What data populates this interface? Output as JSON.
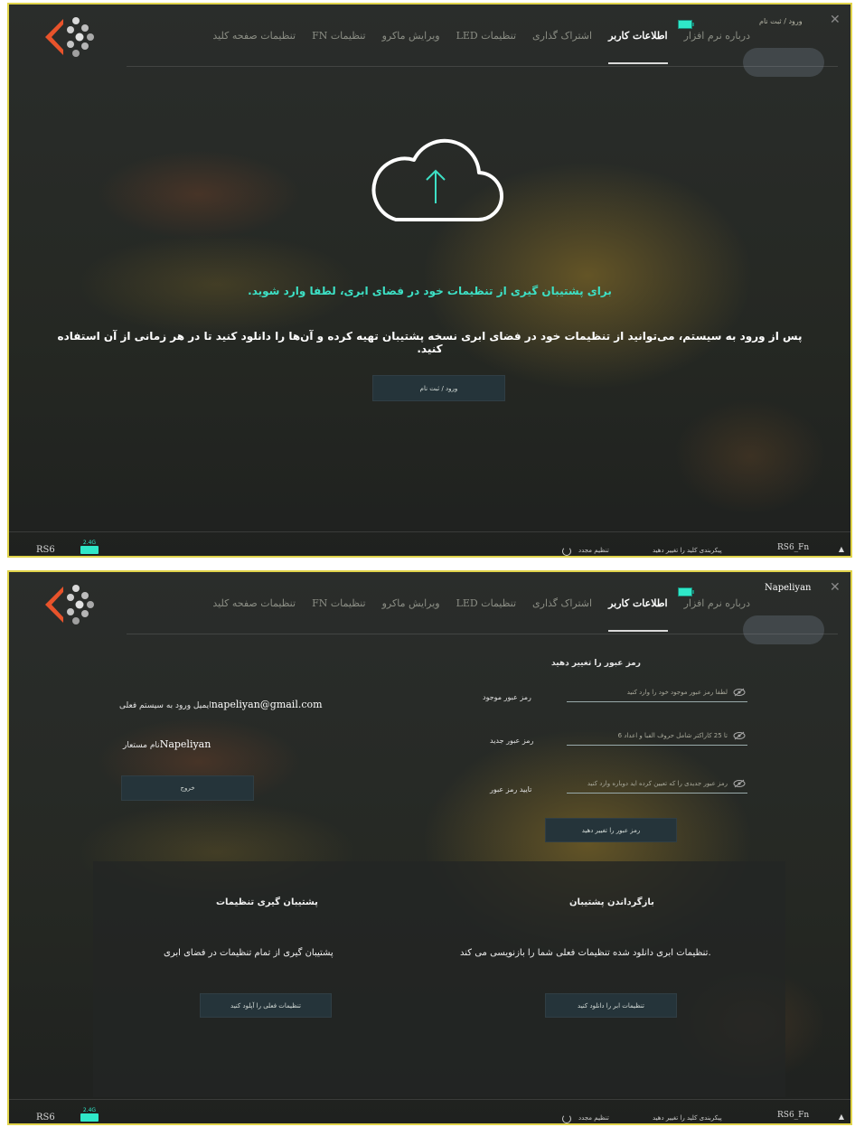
{
  "app": {
    "tabs": [
      "درباره نرم افزار",
      "اطلاعات کاربر",
      "اشتراک گذاری",
      "LED تنظیمات",
      "ویرایش ماکرو",
      "FN تنظیمات",
      "تنظیمات صفحه کلید"
    ],
    "active_tab": "اطلاعات کاربر",
    "battery_color": "#2fe8c8",
    "accent_color": "#3de0c5",
    "logo_color": "#e8532b"
  },
  "screen1": {
    "login_link": "ورود / ثبت نام",
    "cloud_icon": "cloud-upload-icon",
    "message_teal": "برای پشتیبان گیری از تنظیمات خود در فضای ابری، لطفا وارد شوید.",
    "message_white": "پس از ورود به سیستم، می‌توانید از تنظیمات خود در فضای ابری نسخه پشتیبان تهیه کرده و آن‌ها را دانلود کنید تا در هر زمانی از آن استفاده کنید.",
    "login_button": "ورود / ثبت نام"
  },
  "screen2": {
    "username": "Napeliyan",
    "email_label": "ایمیل ورود به سیستم فعلی",
    "email_value": "napeliyan@gmail.com",
    "nickname_label": "نام مستعار",
    "nickname_value": "Napeliyan",
    "logout_button": "خروج",
    "password_section_title": "رمز عبور را تغییر دهید",
    "current_password_label": "رمز عبور موجود",
    "current_password_placeholder": "لطفا رمز عبور موجود خود را وارد کنید",
    "new_password_label": "رمز عبور جدید",
    "new_password_placeholder": "6 تا 25 کاراکتر شامل حروف الفبا و اعداد",
    "confirm_password_label": "تایید رمز عبور",
    "confirm_password_placeholder": "رمز عبور جدیدی را که تعیین کرده اید دوباره وارد کنید",
    "change_password_button": "رمز عبور را تغییر دهید",
    "restore_title": "بازگرداندن پشتیبان",
    "restore_desc": "تنظیمات ابری دانلود شده تنظیمات فعلی شما را بازنویسی می کند.",
    "restore_button": "تنظیمات ابر را دانلود کنید",
    "backup_title": "پشتیبان گیری تنظیمات",
    "backup_desc": "پشتیبان گیری از تمام تنظیمات در فضای ابری",
    "backup_button": "تنظیمات فعلی را آپلود کنید"
  },
  "footer": {
    "device": "RS6",
    "keyboard_badge": "2.4G",
    "reset": "تنظیم مجدد",
    "change_layout": "پیکربندی کلید را تغییر دهید",
    "profile": "RS6_Fn"
  }
}
